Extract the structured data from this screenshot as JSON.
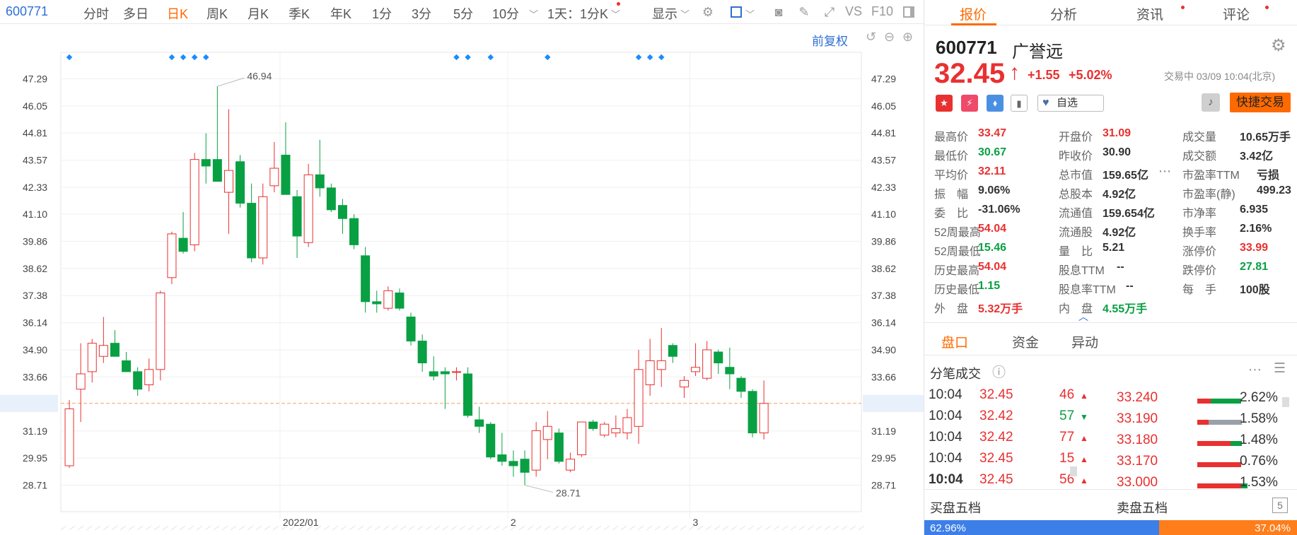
{
  "toolbar": {
    "code": "600771",
    "periods": [
      "分时",
      "多日",
      "日K",
      "周K",
      "月K",
      "季K",
      "年K",
      "1分",
      "3分",
      "5分",
      "10分"
    ],
    "active_period": "日K",
    "interval_select": "1天：1分K",
    "display": "显示",
    "vs": "VS",
    "f10": "F10",
    "adjust": "前复权"
  },
  "chart_data": {
    "type": "candlestick",
    "y_ticks": [
      "47.29",
      "46.05",
      "44.81",
      "43.57",
      "42.33",
      "41.10",
      "39.86",
      "38.62",
      "37.38",
      "36.14",
      "34.90",
      "33.66",
      "32.45",
      "31.19",
      "29.95",
      "28.71"
    ],
    "ylim": [
      27.5,
      48.5
    ],
    "x_labels": [
      {
        "label": "2022/01",
        "index": 19
      },
      {
        "label": "2",
        "index": 39
      },
      {
        "label": "3",
        "index": 55
      }
    ],
    "current_price": 32.45,
    "current_price_label": "32.45",
    "high_annotation": {
      "label": "46.94",
      "index": 13,
      "value": 46.94
    },
    "low_annotation": {
      "label": "28.71",
      "index": 40,
      "value": 28.71
    },
    "event_marker_indices": [
      0,
      9,
      10,
      11,
      12,
      34,
      35,
      37,
      42,
      50,
      51,
      52
    ],
    "candles": [
      {
        "o": 29.6,
        "h": 32.6,
        "l": 29.5,
        "c": 32.2
      },
      {
        "o": 33.1,
        "h": 35.2,
        "l": 31.6,
        "c": 33.8
      },
      {
        "o": 33.9,
        "h": 35.4,
        "l": 33.4,
        "c": 35.2
      },
      {
        "o": 34.6,
        "h": 36.4,
        "l": 34.3,
        "c": 35.1
      },
      {
        "o": 35.2,
        "h": 35.8,
        "l": 34.7,
        "c": 34.6
      },
      {
        "o": 34.4,
        "h": 34.8,
        "l": 33.9,
        "c": 33.9
      },
      {
        "o": 33.9,
        "h": 34.1,
        "l": 32.8,
        "c": 33.1
      },
      {
        "o": 33.3,
        "h": 34.5,
        "l": 33.0,
        "c": 34.0
      },
      {
        "o": 34.0,
        "h": 37.6,
        "l": 33.5,
        "c": 37.5
      },
      {
        "o": 38.2,
        "h": 40.3,
        "l": 37.9,
        "c": 40.2
      },
      {
        "o": 40.0,
        "h": 41.2,
        "l": 39.3,
        "c": 39.4
      },
      {
        "o": 39.7,
        "h": 43.9,
        "l": 39.4,
        "c": 43.6
      },
      {
        "o": 43.6,
        "h": 44.8,
        "l": 42.5,
        "c": 43.3
      },
      {
        "o": 43.6,
        "h": 46.94,
        "l": 42.6,
        "c": 42.6
      },
      {
        "o": 42.1,
        "h": 45.9,
        "l": 40.2,
        "c": 43.1
      },
      {
        "o": 43.5,
        "h": 43.8,
        "l": 41.4,
        "c": 41.6
      },
      {
        "o": 41.6,
        "h": 42.5,
        "l": 38.9,
        "c": 39.1
      },
      {
        "o": 39.1,
        "h": 42.5,
        "l": 38.8,
        "c": 41.9
      },
      {
        "o": 42.4,
        "h": 44.4,
        "l": 42.1,
        "c": 43.2
      },
      {
        "o": 43.8,
        "h": 45.3,
        "l": 42.0,
        "c": 42.0
      },
      {
        "o": 41.9,
        "h": 42.2,
        "l": 39.1,
        "c": 40.1
      },
      {
        "o": 39.8,
        "h": 43.4,
        "l": 39.6,
        "c": 42.9
      },
      {
        "o": 42.9,
        "h": 44.5,
        "l": 41.9,
        "c": 42.3
      },
      {
        "o": 42.3,
        "h": 42.5,
        "l": 41.2,
        "c": 41.3
      },
      {
        "o": 41.5,
        "h": 41.8,
        "l": 40.2,
        "c": 40.9
      },
      {
        "o": 40.9,
        "h": 41.1,
        "l": 39.5,
        "c": 39.7
      },
      {
        "o": 39.2,
        "h": 39.6,
        "l": 36.6,
        "c": 37.1
      },
      {
        "o": 37.1,
        "h": 37.6,
        "l": 36.6,
        "c": 37.0
      },
      {
        "o": 36.8,
        "h": 37.8,
        "l": 36.7,
        "c": 37.6
      },
      {
        "o": 37.5,
        "h": 37.7,
        "l": 36.7,
        "c": 36.8
      },
      {
        "o": 36.4,
        "h": 36.6,
        "l": 35.1,
        "c": 35.3
      },
      {
        "o": 35.3,
        "h": 35.6,
        "l": 33.9,
        "c": 34.3
      },
      {
        "o": 33.9,
        "h": 34.6,
        "l": 33.5,
        "c": 33.7
      },
      {
        "o": 33.9,
        "h": 34.1,
        "l": 32.2,
        "c": 33.8
      },
      {
        "o": 33.9,
        "h": 34.1,
        "l": 33.5,
        "c": 33.9
      },
      {
        "o": 33.8,
        "h": 34.1,
        "l": 31.8,
        "c": 31.9
      },
      {
        "o": 31.7,
        "h": 32.3,
        "l": 31.1,
        "c": 31.4
      },
      {
        "o": 31.5,
        "h": 31.6,
        "l": 29.9,
        "c": 30.0
      },
      {
        "o": 30.1,
        "h": 31.1,
        "l": 29.6,
        "c": 29.8
      },
      {
        "o": 29.8,
        "h": 30.3,
        "l": 29.1,
        "c": 29.6
      },
      {
        "o": 29.9,
        "h": 30.3,
        "l": 28.71,
        "c": 29.3
      },
      {
        "o": 29.4,
        "h": 31.6,
        "l": 29.1,
        "c": 31.2
      },
      {
        "o": 30.8,
        "h": 32.1,
        "l": 29.9,
        "c": 31.4
      },
      {
        "o": 31.1,
        "h": 31.3,
        "l": 29.7,
        "c": 29.8
      },
      {
        "o": 29.4,
        "h": 30.2,
        "l": 29.3,
        "c": 29.9
      },
      {
        "o": 30.1,
        "h": 31.6,
        "l": 30.0,
        "c": 31.6
      },
      {
        "o": 31.6,
        "h": 31.7,
        "l": 31.2,
        "c": 31.3
      },
      {
        "o": 31.0,
        "h": 31.6,
        "l": 30.9,
        "c": 31.5
      },
      {
        "o": 31.1,
        "h": 31.9,
        "l": 30.9,
        "c": 31.3
      },
      {
        "o": 31.1,
        "h": 32.2,
        "l": 30.8,
        "c": 31.8
      },
      {
        "o": 31.4,
        "h": 34.9,
        "l": 30.6,
        "c": 34.0
      },
      {
        "o": 33.3,
        "h": 35.4,
        "l": 32.8,
        "c": 34.4
      },
      {
        "o": 34.0,
        "h": 35.9,
        "l": 33.2,
        "c": 34.4
      },
      {
        "o": 35.1,
        "h": 35.2,
        "l": 34.3,
        "c": 34.6
      },
      {
        "o": 33.2,
        "h": 33.7,
        "l": 32.7,
        "c": 33.5
      },
      {
        "o": 33.9,
        "h": 35.2,
        "l": 33.7,
        "c": 34.1
      },
      {
        "o": 33.6,
        "h": 35.3,
        "l": 33.5,
        "c": 34.9
      },
      {
        "o": 34.8,
        "h": 34.9,
        "l": 33.8,
        "c": 34.3
      },
      {
        "o": 34.1,
        "h": 35.0,
        "l": 33.1,
        "c": 33.8
      },
      {
        "o": 33.6,
        "h": 33.7,
        "l": 32.7,
        "c": 33.0
      },
      {
        "o": 33.0,
        "h": 33.1,
        "l": 30.9,
        "c": 31.1
      },
      {
        "o": 31.1,
        "h": 33.5,
        "l": 30.8,
        "c": 32.45
      }
    ]
  },
  "panel": {
    "tabs": [
      "报价",
      "分析",
      "资讯",
      "评论"
    ],
    "active_tab": "报价",
    "code": "600771",
    "name": "广誉远",
    "price": "32.45",
    "arrow": "↑",
    "change": "+1.55",
    "change_pct": "+5.02%",
    "status": "交易中 03/09 10:04(北京)",
    "watch_label": "自选",
    "quick_trade": "快捷交易",
    "colors": {
      "up": "#e93030",
      "down": "#09a043",
      "accent": "#ff6a00",
      "link": "#2f6fd6"
    },
    "fields": [
      [
        {
          "label": "最高价",
          "value": "33.47",
          "color": "red"
        },
        {
          "label": "开盘价",
          "value": "31.09",
          "color": "red"
        },
        {
          "label": "成交量",
          "value": "10.65万手",
          "color": "dark"
        }
      ],
      [
        {
          "label": "最低价",
          "value": "30.67",
          "color": "green"
        },
        {
          "label": "昨收价",
          "value": "30.90",
          "color": "dark"
        },
        {
          "label": "成交额",
          "value": "3.42亿",
          "color": "dark"
        }
      ],
      [
        {
          "label": "平均价",
          "value": "32.11",
          "color": "red"
        },
        {
          "label": "总市值",
          "value": "159.65亿",
          "color": "dark"
        },
        {
          "label": "市盈率TTM",
          "value": "亏损",
          "color": "dark"
        }
      ],
      [
        {
          "label": "振　幅",
          "value": "9.06%",
          "color": "dark"
        },
        {
          "label": "总股本",
          "value": "4.92亿",
          "color": "dark"
        },
        {
          "label": "市盈率(静)",
          "value": "499.23",
          "color": "dark"
        }
      ],
      [
        {
          "label": "委　比",
          "value": "-31.06%",
          "color": "dark"
        },
        {
          "label": "流通值",
          "value": "159.654亿",
          "color": "dark"
        },
        {
          "label": "市净率",
          "value": "6.935",
          "color": "dark"
        }
      ],
      [
        {
          "label": "52周最高",
          "value": "54.04",
          "color": "red"
        },
        {
          "label": "流通股",
          "value": "4.92亿",
          "color": "dark"
        },
        {
          "label": "换手率",
          "value": "2.16%",
          "color": "dark"
        }
      ],
      [
        {
          "label": "52周最低",
          "value": "15.46",
          "color": "green"
        },
        {
          "label": "量　比",
          "value": "5.21",
          "color": "dark"
        },
        {
          "label": "涨停价",
          "value": "33.99",
          "color": "red"
        }
      ],
      [
        {
          "label": "历史最高",
          "value": "54.04",
          "color": "red"
        },
        {
          "label": "股息TTM",
          "value": "--",
          "color": "dark"
        },
        {
          "label": "跌停价",
          "value": "27.81",
          "color": "green"
        }
      ],
      [
        {
          "label": "历史最低",
          "value": "1.15",
          "color": "green"
        },
        {
          "label": "股息率TTM",
          "value": "--",
          "color": "dark"
        },
        {
          "label": "每　手",
          "value": "100股",
          "color": "dark"
        }
      ],
      [
        {
          "label": "外　盘",
          "value": "5.32万手",
          "color": "red"
        },
        {
          "label": "内　盘",
          "value": "4.55万手",
          "color": "green"
        }
      ]
    ],
    "subtabs": [
      "盘口",
      "资金",
      "异动"
    ],
    "active_subtab": "盘口",
    "trades_title": "分笔成交",
    "trades": [
      {
        "time": "10:04",
        "price": "32.45",
        "vol": "46",
        "dir": "up"
      },
      {
        "time": "10:04",
        "price": "32.42",
        "vol": "57",
        "dir": "down"
      },
      {
        "time": "10:04",
        "price": "32.42",
        "vol": "77",
        "dir": "up"
      },
      {
        "time": "10:04",
        "price": "32.45",
        "vol": "15",
        "dir": "up"
      },
      {
        "time": "10:04",
        "price": "32.45",
        "vol": "56",
        "dir": "up"
      }
    ],
    "dist": [
      {
        "price": "33.240",
        "pct": "2.62%",
        "red": 0.3,
        "green": 0.7,
        "gray": 0
      },
      {
        "price": "33.190",
        "pct": "1.58%",
        "red": 0.25,
        "green": 0,
        "gray": 0.75
      },
      {
        "price": "33.180",
        "pct": "1.48%",
        "red": 0.75,
        "green": 0.25,
        "gray": 0
      },
      {
        "price": "33.170",
        "pct": "0.76%",
        "red": 1.0,
        "green": 0,
        "gray": 0
      },
      {
        "price": "33.000",
        "pct": "1.53%",
        "red": 1.0,
        "green": 0.15,
        "gray": 0
      }
    ],
    "buy5": "买盘五档",
    "sell5": "卖盘五档",
    "buy_pct": "62.96%",
    "sell_pct": "37.04%",
    "buy_ratio": 0.6296
  }
}
